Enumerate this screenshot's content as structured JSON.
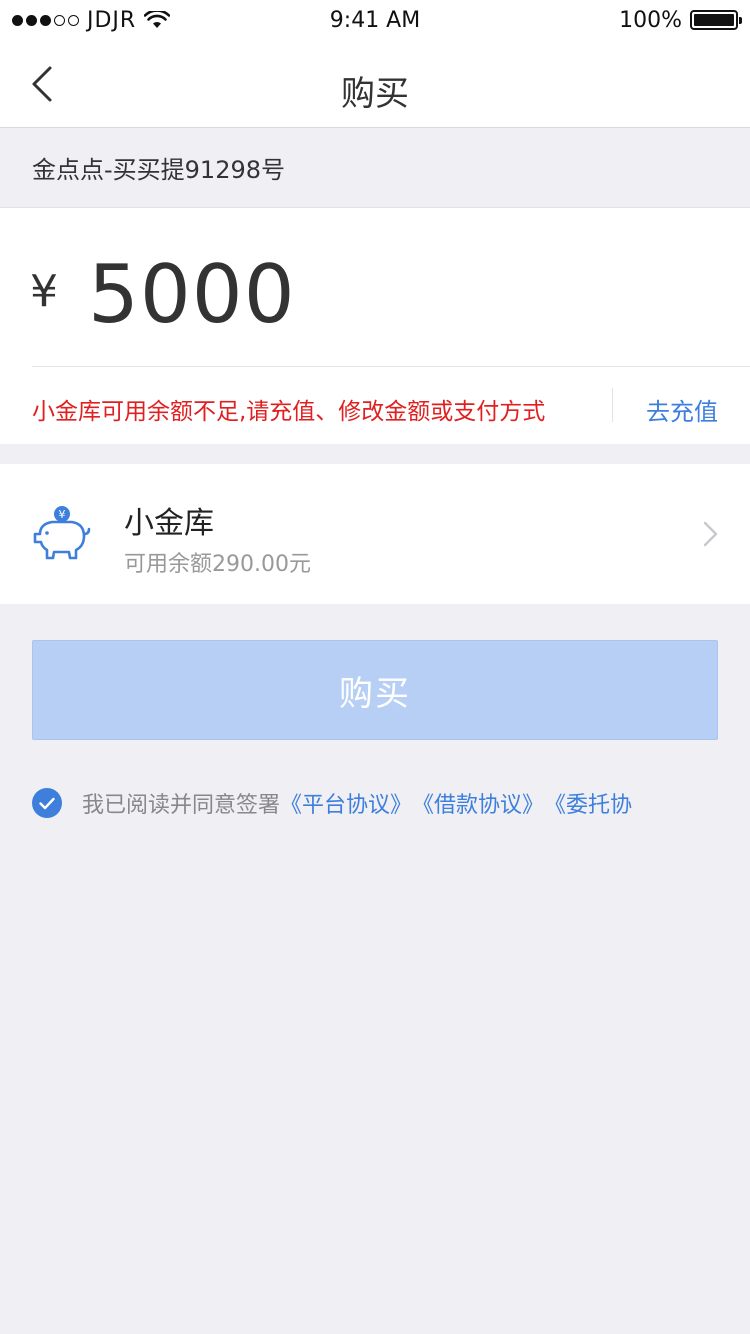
{
  "status_bar": {
    "carrier": "JDJR",
    "time": "9:41 AM",
    "battery": "100%",
    "signal_filled": 3,
    "signal_total": 5
  },
  "nav": {
    "title": "购买"
  },
  "product": {
    "name": "金点点-买买提91298号"
  },
  "amount": {
    "currency_symbol": "¥",
    "value": "5000",
    "warning": "小金库可用余额不足,请充值、修改金额或支付方式",
    "recharge_label": "去充值"
  },
  "payment_method": {
    "name": "小金库",
    "balance": "可用余额290.00元",
    "icon": "piggy-bank-icon"
  },
  "buy_button": {
    "label": "购买"
  },
  "agreement": {
    "prefix": "我已阅读并同意签署",
    "links": [
      "《平台协议》",
      "《借款协议》",
      "《委托协"
    ]
  },
  "colors": {
    "accent": "#3e7fdc",
    "warning": "#e02020",
    "button_disabled": "#b7cff5",
    "background": "#efeff4"
  }
}
